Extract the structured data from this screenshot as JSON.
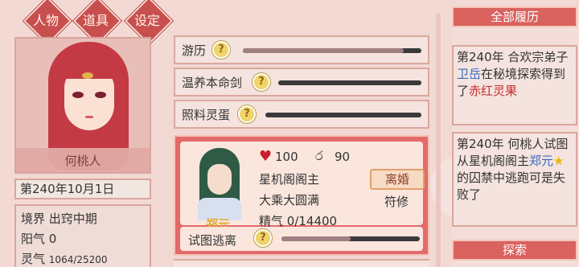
{
  "tabs": [
    {
      "label": "人物"
    },
    {
      "label": "道具"
    },
    {
      "label": "设定"
    }
  ],
  "profile": {
    "name": "何桃人",
    "date": "第240年10月1日",
    "realm_label": "境界",
    "realm_value": "出窍中期",
    "yang_label": "阳气",
    "yang_value": "0",
    "spirit_label": "灵气",
    "spirit_value": "1064/25200"
  },
  "tasks": [
    {
      "label": "游历",
      "progress": 0.9
    },
    {
      "label": "温养本命剑",
      "progress": 0.0
    },
    {
      "label": "照料灵蛋",
      "progress": 0.0
    }
  ],
  "character": {
    "name": "郑元",
    "hp": "100",
    "mood": "90",
    "title": "星机阁阁主",
    "cultivation": "大乘大圆满",
    "essence": "精气 0/14400",
    "action_button": "离婚",
    "relation": "符修",
    "current_task": "试图逃离",
    "task_progress": 0.5
  },
  "history": {
    "header": "全部履历",
    "entries": [
      {
        "p1": "第240年 合欢宗弟子",
        "name": "卫岳",
        "p2": "在秘境探索得到了",
        "item": "赤红灵果"
      },
      {
        "p1": "第240年 何桃人试图从星机阁阁主",
        "name": "郑元",
        "p2": "的囚禁中逃跑可是失败了"
      }
    ],
    "explore_button": "探索"
  },
  "icons": {
    "question": "?",
    "heart": "♥",
    "ring": "ර",
    "star": "★"
  },
  "colors": {
    "accent": "#d9625f",
    "card": "#e36a6a",
    "highlight_blue": "#3a6cc0",
    "highlight_red": "#c43030",
    "name_gold": "#e0b030"
  }
}
